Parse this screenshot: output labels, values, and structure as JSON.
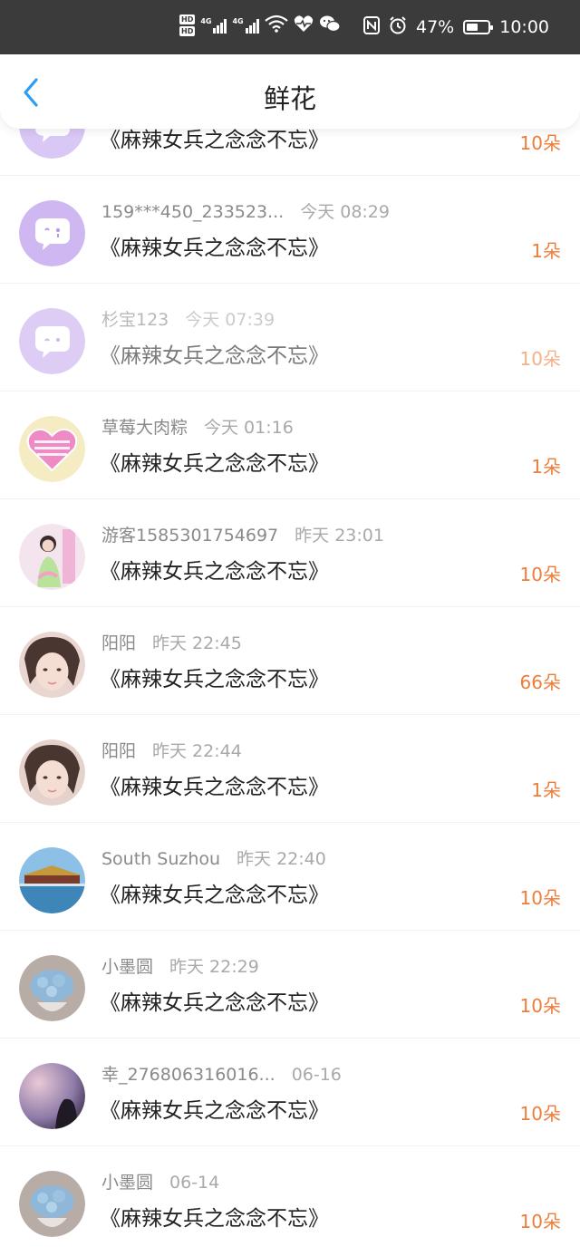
{
  "status_bar": {
    "hd_top": "HD",
    "hd_bottom": "HD",
    "net1": "4G",
    "net2": "4G",
    "wifi_num": "6",
    "battery": "47%",
    "time": "10:00"
  },
  "header": {
    "title": "鲜花"
  },
  "rows": [
    {
      "name": "",
      "time": "",
      "title": "《麻辣女兵之念念不忘》",
      "count": "10朵",
      "avatar": "chat-bubble"
    },
    {
      "name": "159***450_233523...",
      "time": "今天 08:29",
      "title": "《麻辣女兵之念念不忘》",
      "count": "1朵",
      "avatar": "chat-bubble"
    },
    {
      "name": "杉宝123",
      "time": "今天 07:39",
      "title": "《麻辣女兵之念念不忘》",
      "count": "10朵",
      "avatar": "chat-bubble"
    },
    {
      "name": "草莓大肉粽",
      "time": "今天 01:16",
      "title": "《麻辣女兵之念念不忘》",
      "count": "1朵",
      "avatar": "heart-sticker"
    },
    {
      "name": "游客1585301754697",
      "time": "昨天 23:01",
      "title": "《麻辣女兵之念念不忘》",
      "count": "10朵",
      "avatar": "photo-girl-pink"
    },
    {
      "name": "阳阳",
      "time": "昨天 22:45",
      "title": "《麻辣女兵之念念不忘》",
      "count": "66朵",
      "avatar": "photo-girl-face"
    },
    {
      "name": "阳阳",
      "time": "昨天 22:44",
      "title": "《麻辣女兵之念念不忘》",
      "count": "1朵",
      "avatar": "photo-girl-face"
    },
    {
      "name": "South Suzhou",
      "time": "昨天 22:40",
      "title": "《麻辣女兵之念念不忘》",
      "count": "10朵",
      "avatar": "photo-palace"
    },
    {
      "name": "小墨圆",
      "time": "昨天 22:29",
      "title": "《麻辣女兵之念念不忘》",
      "count": "10朵",
      "avatar": "photo-flowers"
    },
    {
      "name": "幸_276806316016...",
      "time": "06-16",
      "title": "《麻辣女兵之念念不忘》",
      "count": "10朵",
      "avatar": "photo-dusk"
    },
    {
      "name": "小墨圆",
      "time": "06-14",
      "title": "《麻辣女兵之念念不忘》",
      "count": "10朵",
      "avatar": "photo-flowers"
    }
  ]
}
